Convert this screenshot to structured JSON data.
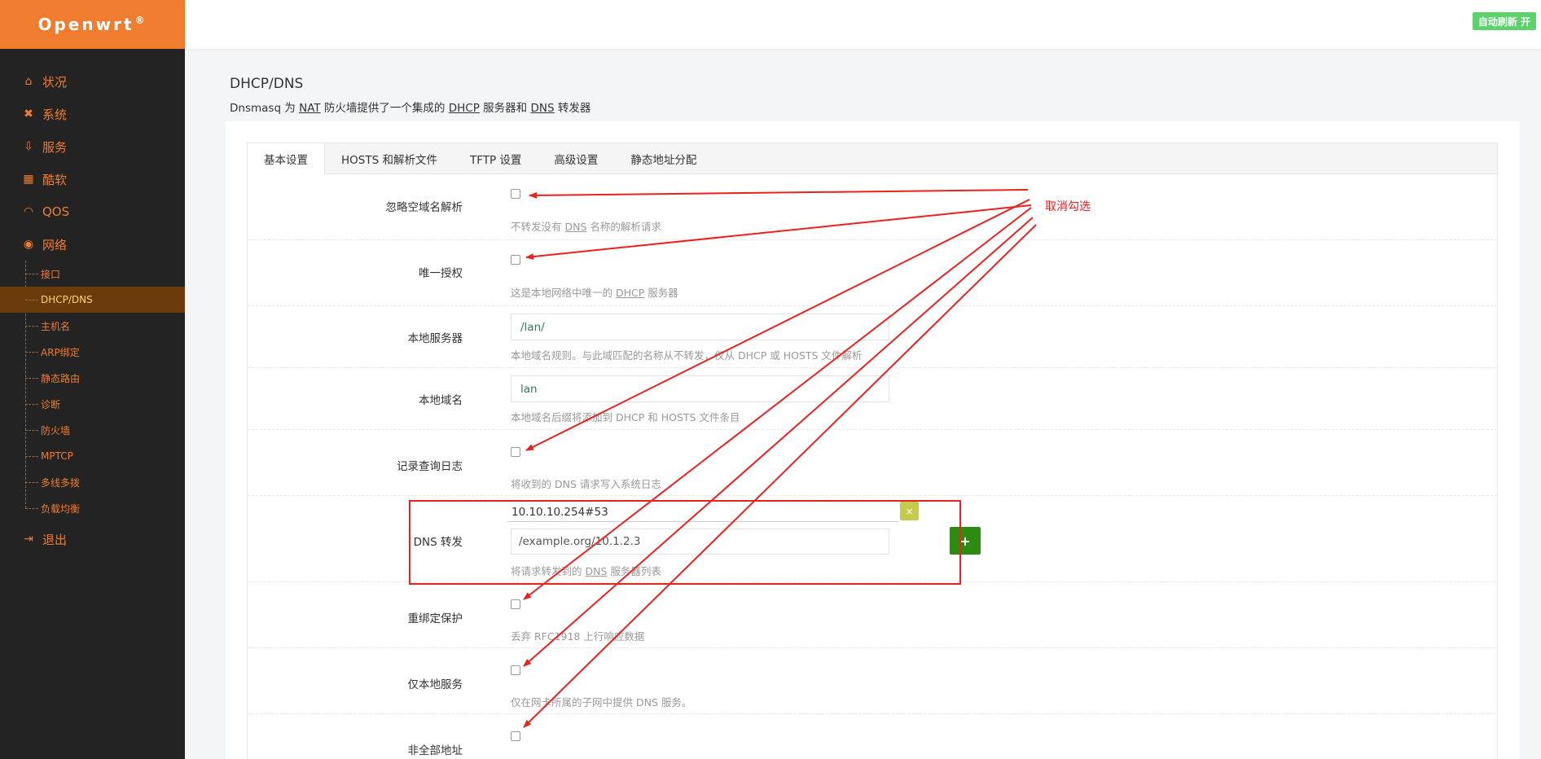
{
  "brand": {
    "name": "Openwrt",
    "reg": "®"
  },
  "nav": {
    "status": "状况",
    "system": "系统",
    "services": "服务",
    "cool": "酷软",
    "qos": "QOS",
    "network": "网络",
    "sub": [
      "接口",
      "DHCP/DNS",
      "主机名",
      "ARP绑定",
      "静态路由",
      "诊断",
      "防火墙",
      "MPTCP",
      "多线多拨",
      "负载均衡"
    ],
    "logout": "退出"
  },
  "header": {
    "auto_refresh": "自动刷新 开"
  },
  "page": {
    "title": "DHCP/DNS",
    "desc_prefix": "Dnsmasq 为 ",
    "desc_nat": "NAT",
    "desc_mid": " 防火墙提供了一个集成的 ",
    "desc_dhcp": "DHCP",
    "desc_mid2": " 服务器和 ",
    "desc_dns": "DNS",
    "desc_suffix": " 转发器"
  },
  "tabs": [
    "基本设置",
    "HOSTS 和解析文件",
    "TFTP 设置",
    "高级设置",
    "静态地址分配"
  ],
  "form": {
    "domainneeded": {
      "label": "忽略空域名解析",
      "help_a": "不转发没有 ",
      "help_u": "DNS",
      "help_b": " 名称的解析请求",
      "checked": false
    },
    "authoritative": {
      "label": "唯一授权",
      "help_a": "这是本地网络中唯一的 ",
      "help_u": "DHCP",
      "help_b": " 服务器",
      "checked": false
    },
    "local": {
      "label": "本地服务器",
      "value": "/lan/",
      "help": "本地域名规则。与此域匹配的名称从不转发，仅从 DHCP 或 HOSTS 文件解析"
    },
    "domain": {
      "label": "本地域名",
      "value": "lan",
      "help": "本地域名后缀将添加到 DHCP 和 HOSTS 文件条目"
    },
    "logqueries": {
      "label": "记录查询日志",
      "help": "将收到的 DNS 请求写入系统日志",
      "checked": false
    },
    "dns_forward": {
      "label": "DNS 转发",
      "value": "10.10.10.254#53",
      "remove": "×",
      "placeholder": "/example.org/10.1.2.3",
      "add": "+",
      "help_a": "将请求转发到的 ",
      "help_u": "DNS",
      "help_b": " 服务器列表"
    },
    "rebind": {
      "label": "重绑定保护",
      "help": "丢弃 RFC1918 上行响应数据",
      "checked": false
    },
    "localservice": {
      "label": "仅本地服务",
      "help": "仅在网卡所属的子网中提供 DNS 服务。",
      "checked": false
    },
    "nonwildcard": {
      "label": "非全部地址",
      "checked": false
    }
  },
  "annotation": {
    "text": "取消勾选",
    "color": "#e8221e"
  }
}
